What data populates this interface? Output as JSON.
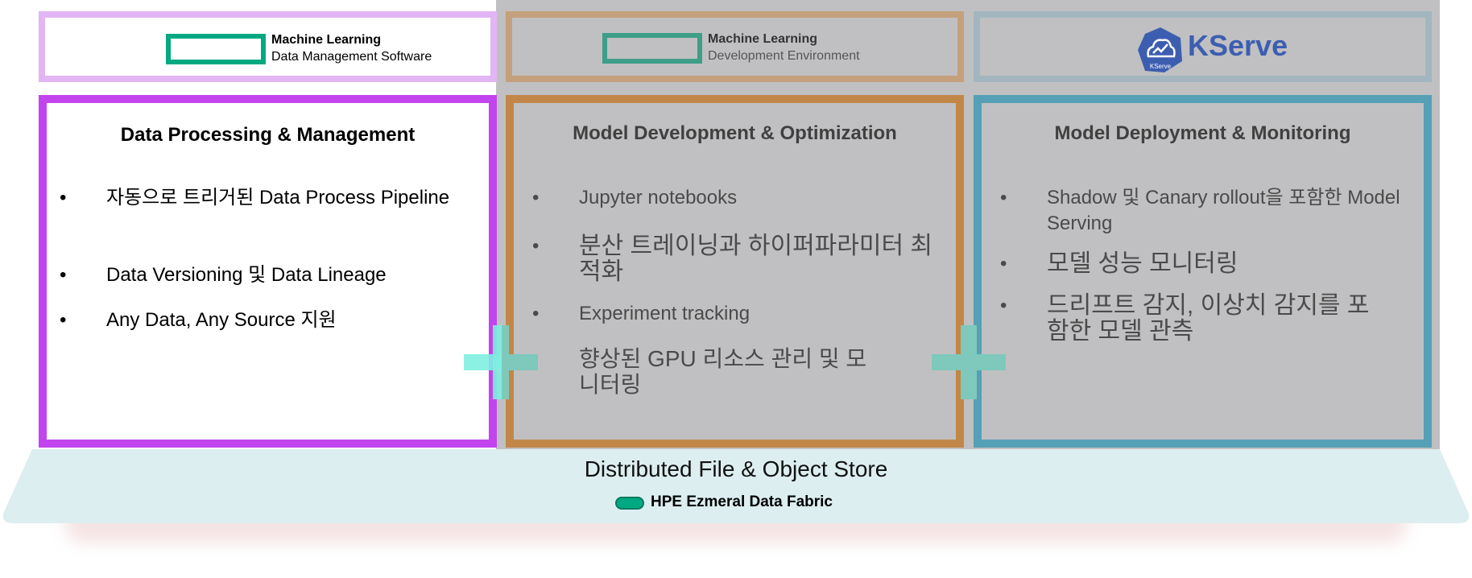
{
  "colors": {
    "hpe_green": "#01a982",
    "purple": "#c244ee",
    "orange": "#c28748",
    "blue": "#55a0b7",
    "grey": "#c0c0c2",
    "teal_plus": "#7ef0e0",
    "kserve_blue": "#3d5eb0"
  },
  "logos": {
    "mldm": {
      "title": "Machine Learning",
      "subtitle": "Data Management Software",
      "icon": "hpe-logo-icon"
    },
    "mlde": {
      "title": "Machine Learning",
      "subtitle": "Development Environment",
      "icon": "hpe-logo-icon"
    },
    "kserve": {
      "name": "KServe",
      "badge": "KServe",
      "icon": "kserve-cloud-icon"
    }
  },
  "panels": [
    {
      "title": "Data Processing & Management",
      "items": [
        "자동으로 트리거된 Data Process Pipeline",
        "Data Versioning 및 Data Lineage",
        "Any Data, Any Source 지원"
      ]
    },
    {
      "title": "Model Development & Optimization",
      "items": [
        "Jupyter notebooks",
        "분산 트레이닝과 하이퍼파라미터 최적화",
        "Experiment tracking",
        "향상된 GPU 리소스 관리 및 모니터링"
      ]
    },
    {
      "title": "Model Deployment & Monitoring",
      "items": [
        "Shadow 및 Canary rollout을 포함한 Model Serving",
        "모델 성능 모니터링",
        "드리프트 감지, 이상치 감지를 포함한 모델 관측"
      ]
    }
  ],
  "bullet": "•",
  "base": {
    "title": "Distributed File & Object Store",
    "fabric_label": "HPE Ezmeral Data Fabric",
    "fabric_icon": "hpe-ezmeral-icon"
  }
}
